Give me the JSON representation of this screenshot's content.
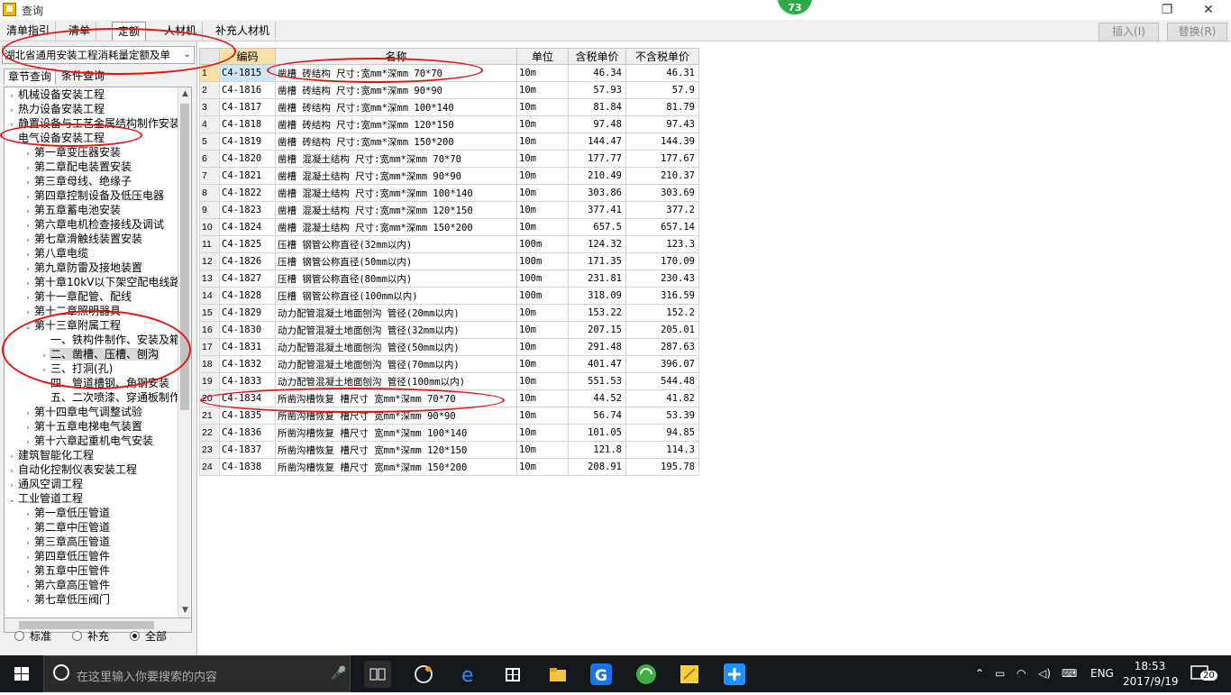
{
  "window": {
    "title": "查询",
    "badge": "73"
  },
  "tabs": [
    {
      "label": "清单指引",
      "active": false
    },
    {
      "label": "清单",
      "active": false
    },
    {
      "label": "定额",
      "active": true
    },
    {
      "label": "人材机",
      "active": false
    },
    {
      "label": "补充人材机",
      "active": false
    }
  ],
  "toolbar": {
    "insert_label": "插入(I)",
    "replace_label": "替换(R)"
  },
  "left": {
    "library": "湖北省通用安装工程消耗量定额及单",
    "subtabs": [
      "章节查询",
      "条件查询"
    ],
    "tree": [
      {
        "label": "机械设备安装工程",
        "level": 0,
        "tw": "›"
      },
      {
        "label": "热力设备安装工程",
        "level": 0,
        "tw": "›"
      },
      {
        "label": "静置设备与工艺金属结构制作安装",
        "level": 0,
        "tw": "›"
      },
      {
        "label": "电气设备安装工程",
        "level": 0,
        "tw": "⌄"
      },
      {
        "label": "第一章变压器安装",
        "level": 1,
        "tw": "›"
      },
      {
        "label": "第二章配电装置安装",
        "level": 1,
        "tw": "›"
      },
      {
        "label": "第三章母线、绝缘子",
        "level": 1,
        "tw": "›"
      },
      {
        "label": "第四章控制设备及低压电器",
        "level": 1,
        "tw": "›"
      },
      {
        "label": "第五章蓄电池安装",
        "level": 1,
        "tw": "›"
      },
      {
        "label": "第六章电机检查接线及调试",
        "level": 1,
        "tw": "›"
      },
      {
        "label": "第七章滑触线装置安装",
        "level": 1,
        "tw": "›"
      },
      {
        "label": "第八章电缆",
        "level": 1,
        "tw": "›"
      },
      {
        "label": "第九章防雷及接地装置",
        "level": 1,
        "tw": "›"
      },
      {
        "label": "第十章10kV以下架空配电线路",
        "level": 1,
        "tw": "›"
      },
      {
        "label": "第十一章配管、配线",
        "level": 1,
        "tw": "›"
      },
      {
        "label": "第十二章照明器具",
        "level": 1,
        "tw": "›"
      },
      {
        "label": "第十三章附属工程",
        "level": 1,
        "tw": "⌄"
      },
      {
        "label": "一、铁构件制作、安装及箱",
        "level": 2,
        "tw": ""
      },
      {
        "label": "二、凿槽、压槽、刨沟",
        "level": 2,
        "tw": "›",
        "selected": true
      },
      {
        "label": "三、打洞(孔)",
        "level": 2,
        "tw": "›"
      },
      {
        "label": "四、管道槽钢、角钢安装",
        "level": 2,
        "tw": ""
      },
      {
        "label": "五、二次喷漆、穿通板制作",
        "level": 2,
        "tw": ""
      },
      {
        "label": "第十四章电气调整试验",
        "level": 1,
        "tw": "›"
      },
      {
        "label": "第十五章电梯电气装置",
        "level": 1,
        "tw": "›"
      },
      {
        "label": "第十六章起重机电气安装",
        "level": 1,
        "tw": "›"
      },
      {
        "label": "建筑智能化工程",
        "level": 0,
        "tw": "›"
      },
      {
        "label": "自动化控制仪表安装工程",
        "level": 0,
        "tw": "›"
      },
      {
        "label": "通风空调工程",
        "level": 0,
        "tw": "›"
      },
      {
        "label": "工业管道工程",
        "level": 0,
        "tw": "⌄"
      },
      {
        "label": "第一章低压管道",
        "level": 1,
        "tw": "›"
      },
      {
        "label": "第二章中压管道",
        "level": 1,
        "tw": "›"
      },
      {
        "label": "第三章高压管道",
        "level": 1,
        "tw": "›"
      },
      {
        "label": "第四章低压管件",
        "level": 1,
        "tw": "›"
      },
      {
        "label": "第五章中压管件",
        "level": 1,
        "tw": "›"
      },
      {
        "label": "第六章高压管件",
        "level": 1,
        "tw": "›"
      },
      {
        "label": "第七章低压阀门",
        "level": 1,
        "tw": "›"
      }
    ],
    "filters": [
      {
        "label": "标准",
        "checked": false
      },
      {
        "label": "补充",
        "checked": false
      },
      {
        "label": "全部",
        "checked": true
      }
    ]
  },
  "grid": {
    "headers": [
      "编码",
      "名称",
      "单位",
      "含税单价",
      "不含税单价"
    ],
    "current_row": 1,
    "rows": [
      [
        "1",
        "C4-1815",
        "凿槽 砖结构 尺寸:宽mm*深mm 70*70",
        "10m",
        "46.34",
        "46.31"
      ],
      [
        "2",
        "C4-1816",
        "凿槽 砖结构 尺寸:宽mm*深mm 90*90",
        "10m",
        "57.93",
        "57.9"
      ],
      [
        "3",
        "C4-1817",
        "凿槽 砖结构 尺寸:宽mm*深mm 100*140",
        "10m",
        "81.84",
        "81.79"
      ],
      [
        "4",
        "C4-1818",
        "凿槽 砖结构 尺寸:宽mm*深mm 120*150",
        "10m",
        "97.48",
        "97.43"
      ],
      [
        "5",
        "C4-1819",
        "凿槽 砖结构 尺寸:宽mm*深mm 150*200",
        "10m",
        "144.47",
        "144.39"
      ],
      [
        "6",
        "C4-1820",
        "凿槽 混凝土结构 尺寸:宽mm*深mm 70*70",
        "10m",
        "177.77",
        "177.67"
      ],
      [
        "7",
        "C4-1821",
        "凿槽 混凝土结构 尺寸:宽mm*深mm 90*90",
        "10m",
        "210.49",
        "210.37"
      ],
      [
        "8",
        "C4-1822",
        "凿槽 混凝土结构 尺寸:宽mm*深mm 100*140",
        "10m",
        "303.86",
        "303.69"
      ],
      [
        "9",
        "C4-1823",
        "凿槽 混凝土结构 尺寸:宽mm*深mm 120*150",
        "10m",
        "377.41",
        "377.2"
      ],
      [
        "10",
        "C4-1824",
        "凿槽 混凝土结构 尺寸:宽mm*深mm 150*200",
        "10m",
        "657.5",
        "657.14"
      ],
      [
        "11",
        "C4-1825",
        "压槽 钢管公称直径(32mm以内)",
        "100m",
        "124.32",
        "123.3"
      ],
      [
        "12",
        "C4-1826",
        "压槽 钢管公称直径(50mm以内)",
        "100m",
        "171.35",
        "170.09"
      ],
      [
        "13",
        "C4-1827",
        "压槽 钢管公称直径(80mm以内)",
        "100m",
        "231.81",
        "230.43"
      ],
      [
        "14",
        "C4-1828",
        "压槽 钢管公称直径(100mm以内)",
        "100m",
        "318.09",
        "316.59"
      ],
      [
        "15",
        "C4-1829",
        "动力配管混凝土地面刨沟 管径(20mm以内)",
        "10m",
        "153.22",
        "152.2"
      ],
      [
        "16",
        "C4-1830",
        "动力配管混凝土地面刨沟 管径(32mm以内)",
        "10m",
        "207.15",
        "205.01"
      ],
      [
        "17",
        "C4-1831",
        "动力配管混凝土地面刨沟 管径(50mm以内)",
        "10m",
        "291.48",
        "287.63"
      ],
      [
        "18",
        "C4-1832",
        "动力配管混凝土地面刨沟 管径(70mm以内)",
        "10m",
        "401.47",
        "396.07"
      ],
      [
        "19",
        "C4-1833",
        "动力配管混凝土地面刨沟 管径(100mm以内)",
        "10m",
        "551.53",
        "544.48"
      ],
      [
        "20",
        "C4-1834",
        "所凿沟槽恢复 槽尺寸 宽mm*深mm 70*70",
        "10m",
        "44.52",
        "41.82"
      ],
      [
        "21",
        "C4-1835",
        "所凿沟槽恢复 槽尺寸 宽mm*深mm 90*90",
        "10m",
        "56.74",
        "53.39"
      ],
      [
        "22",
        "C4-1836",
        "所凿沟槽恢复 槽尺寸 宽mm*深mm 100*140",
        "10m",
        "101.05",
        "94.85"
      ],
      [
        "23",
        "C4-1837",
        "所凿沟槽恢复 槽尺寸 宽mm*深mm 120*150",
        "10m",
        "121.8",
        "114.3"
      ],
      [
        "24",
        "C4-1838",
        "所凿沟槽恢复 槽尺寸 宽mm*深mm 150*200",
        "10m",
        "208.91",
        "195.78"
      ]
    ]
  },
  "taskbar": {
    "search_placeholder": "在这里输入你要搜索的内容",
    "ime": "ENG",
    "time": "18:53",
    "date": "2017/9/19",
    "notifications": "20"
  }
}
